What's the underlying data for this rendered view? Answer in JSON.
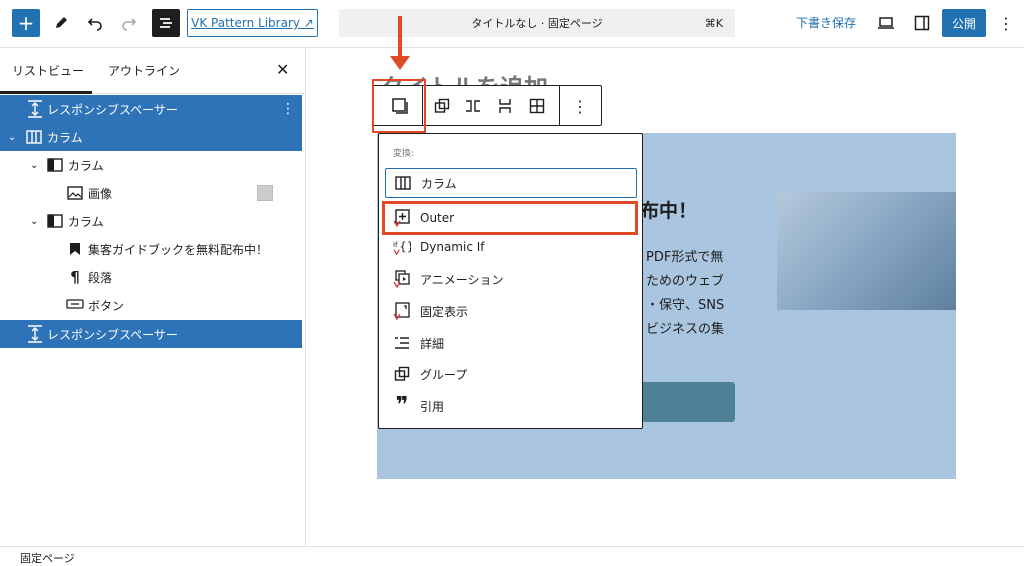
{
  "header": {
    "vk_pattern_link": "VK Pattern Library ↗",
    "command_bar_title": "タイトルなし · 固定ページ",
    "command_shortcut": "⌘K",
    "save_draft": "下書き保存",
    "publish": "公開"
  },
  "sidebar": {
    "tabs": [
      "リストビュー",
      "アウトライン"
    ],
    "items": [
      {
        "label": "レスポンシブスペーサー",
        "icon": "spacer-icon",
        "selected": true
      },
      {
        "label": "カラム",
        "icon": "columns-icon",
        "selected": true
      },
      {
        "label": "カラム",
        "icon": "column-icon",
        "selected": false
      },
      {
        "label": "画像",
        "icon": "image-icon",
        "selected": false
      },
      {
        "label": "カラム",
        "icon": "column-icon",
        "selected": false
      },
      {
        "label": "集客ガイドブックを無料配布中！",
        "icon": "bookmark-icon",
        "selected": false
      },
      {
        "label": "段落",
        "icon": "paragraph-icon",
        "selected": false
      },
      {
        "label": "ボタン",
        "icon": "button-icon",
        "selected": false
      },
      {
        "label": "レスポンシブスペーサー",
        "icon": "spacer-icon",
        "selected": true
      }
    ]
  },
  "canvas": {
    "title_placeholder": "タイトルを追加",
    "heading_fragment": "布中！",
    "paragraph_lines": [
      "PDF形式で無",
      "ためのウェブ",
      "・保守、SNS",
      "ビジネスの集"
    ]
  },
  "transform_menu": {
    "heading": "変換:",
    "items": [
      {
        "label": "カラム",
        "icon": "columns-icon"
      },
      {
        "label": "Outer",
        "icon": "outer-icon"
      },
      {
        "label": "Dynamic If",
        "icon": "dynamic-if-icon"
      },
      {
        "label": "アニメーション",
        "icon": "animation-icon"
      },
      {
        "label": "固定表示",
        "icon": "fixed-display-icon"
      },
      {
        "label": "詳細",
        "icon": "details-icon"
      },
      {
        "label": "グループ",
        "icon": "group-icon"
      },
      {
        "label": "引用",
        "icon": "quote-icon"
      }
    ]
  },
  "footer": {
    "breadcrumb": "固定ページ"
  },
  "colors": {
    "accent": "#2271b1",
    "selected_row": "#2e73b8",
    "highlight": "#e04a27",
    "cover_bg": "#aac5df"
  }
}
